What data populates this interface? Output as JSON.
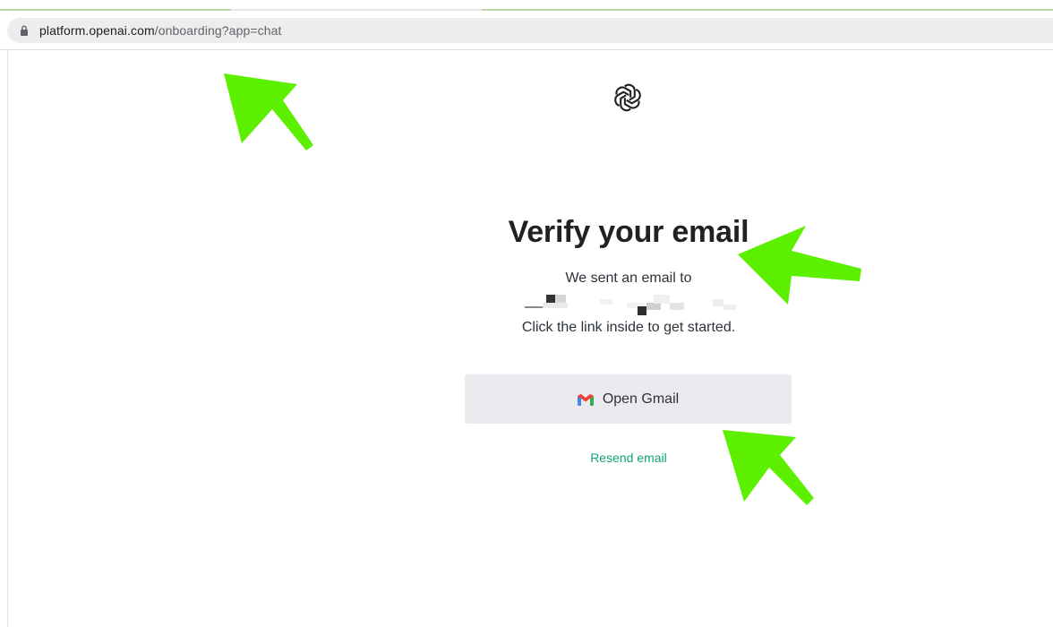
{
  "browser": {
    "url_host": "platform.openai.com",
    "url_path": "/onboarding?app=chat"
  },
  "page": {
    "logo_icon": "openai-logo-icon",
    "title": "Verify your email",
    "sent_line": "We sent an email to",
    "instructions": "Click the link inside to get started.",
    "open_gmail_label": "Open Gmail",
    "gmail_icon": "gmail-icon",
    "resend_label": "Resend email"
  },
  "colors": {
    "accent_link": "#10a37f",
    "button_bg": "#ebebef",
    "annotation_arrow": "#5cf000"
  }
}
